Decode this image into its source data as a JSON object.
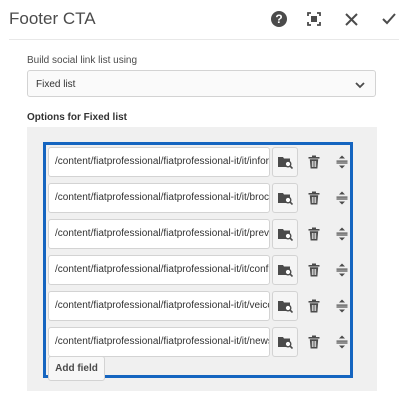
{
  "dialog": {
    "title": "Footer CTA"
  },
  "header_actions": [
    {
      "icon": "help-icon",
      "glyph": "?"
    },
    {
      "icon": "fullscreen-icon"
    },
    {
      "icon": "close-icon"
    },
    {
      "icon": "check-icon"
    }
  ],
  "build_select": {
    "label": "Build social link list using",
    "value": "Fixed list"
  },
  "options": {
    "label": "Options for Fixed list",
    "fields": [
      "/content/fiatprofessional/fiatprofessional-it/it/inform",
      "/content/fiatprofessional/fiatprofessional-it/it/brochu",
      "/content/fiatprofessional/fiatprofessional-it/it/prever",
      "/content/fiatprofessional/fiatprofessional-it/it/configu",
      "/content/fiatprofessional/fiatprofessional-it/it/veicoli",
      "/content/fiatprofessional/fiatprofessional-it/it/newsle"
    ],
    "add_label": "Add field"
  },
  "colors": {
    "highlight": "#1565c0",
    "panel": "#f0f0f0",
    "icon": "#4b4b4b"
  }
}
